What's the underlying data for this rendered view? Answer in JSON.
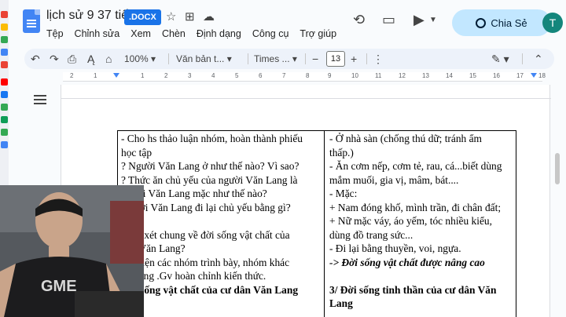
{
  "app": {
    "doc_title": "lịch sử 9 37 tiết",
    "file_badge": ".DOCX",
    "menu": [
      "Tệp",
      "Chỉnh sửa",
      "Xem",
      "Chèn",
      "Định dạng",
      "Công cụ",
      "Trợ giúp"
    ],
    "share_label": "Chia Sẻ",
    "avatar_letter": "T"
  },
  "toolbar": {
    "zoom": "100%",
    "style": "Văn bản t...",
    "font": "Times ...",
    "font_size": "13"
  },
  "ruler": {
    "numbers": [
      "2",
      "1",
      "1",
      "2",
      "3",
      "4",
      "5",
      "6",
      "7",
      "8",
      "9",
      "10",
      "11",
      "12",
      "13",
      "14",
      "15",
      "16",
      "17",
      "18"
    ]
  },
  "table": {
    "left_lines": [
      "- Cho hs thảo luận nhóm, hoàn thành phiếu",
      "học tập",
      "?  Người Văn Lang ở như thế nào? Vì sao?",
      "?  Thức ăn chủ yếu của người Văn Lang là",
      "   người Văn Lang mặc như thế nào?",
      "   Người Văn Lang đi lại chủ yếu bằng gì?",
      "   nào?",
      "   nhận xét chung về đời sống vật chất của",
      "   dân Văn Lang?",
      "   đại diện các nhóm trình bày, nhóm khác",
      "   bổ sung .Gv hoàn chỉnh kiến thức.",
      "   Đời sống vật chất của cư dân Văn Lang"
    ],
    "right_lines": [
      "- Ở nhà sàn (chống thú dữ; tránh ẩm",
      "thấp.)",
      "- Ăn cơm nếp, cơm tẻ, rau, cá...biết dùng",
      "mắm muối, gia vị, mâm, bát....",
      "- Mặc:",
      "+ Nam đóng khố, mình trần, đi chân đất;",
      "+ Nữ mặc váy, áo yếm, tóc nhiều kiểu,",
      "dùng đồ trang sức...",
      "- Đi lại bằng thuyền, voi, ngựa.",
      "-> Đời sống vật chất  được nâng cao",
      "",
      "3/ Đời sống tinh thần của cư dân Văn",
      "Lang"
    ]
  },
  "colors": {
    "accent": "#1a73e8",
    "share_bg": "#c2e7ff",
    "avatar": "#14867c"
  }
}
